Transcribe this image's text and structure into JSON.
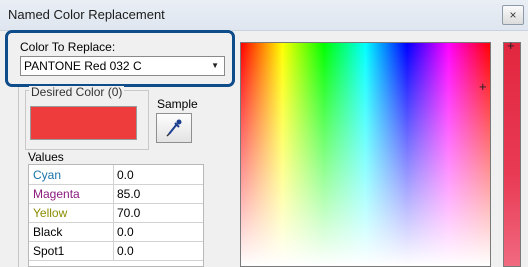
{
  "window": {
    "title": "Named Color Replacement",
    "close_glyph": "×"
  },
  "color_to_replace": {
    "label": "Color To Replace:",
    "selected": "PANTONE Red 032 C"
  },
  "desired_color": {
    "label": "Desired Color (0)",
    "swatch_color": "#ee3b3b"
  },
  "sample": {
    "label": "Sample",
    "icon": "eyedropper-icon"
  },
  "values": {
    "label": "Values",
    "rows": [
      {
        "name": "Cyan",
        "value": "0.0",
        "color": "#1a73a8"
      },
      {
        "name": "Magenta",
        "value": "85.0",
        "color": "#8b1a7e"
      },
      {
        "name": "Yellow",
        "value": "70.0",
        "color": "#8c8c00"
      },
      {
        "name": "Black",
        "value": "0.0",
        "color": "#000000"
      },
      {
        "name": "Spot1",
        "value": "0.0",
        "color": "#000000"
      }
    ]
  },
  "picker": {
    "crosshair": "+",
    "strip_marker": "+"
  }
}
